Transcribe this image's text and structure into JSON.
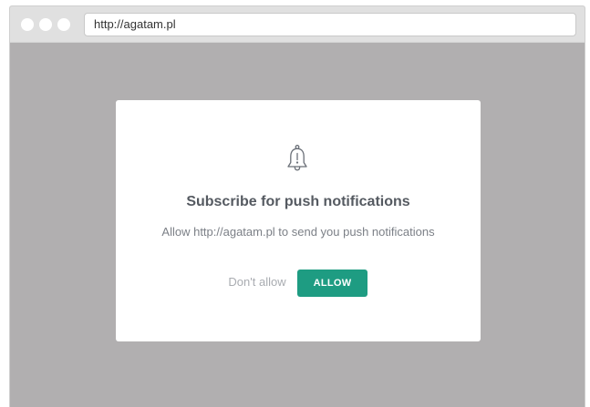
{
  "browser": {
    "url": "http://agatam.pl",
    "window_controls": [
      "window-dot-icon",
      "window-dot-icon",
      "window-dot-icon"
    ]
  },
  "dialog": {
    "icon": "bell-icon",
    "title": "Subscribe for push notifications",
    "message": "Allow http://agatam.pl to send you push notifications",
    "deny_label": "Don't allow",
    "allow_label": "ALLOW"
  },
  "colors": {
    "overlay": "#b1afb0",
    "toolbar": "#e0e0e0",
    "accent": "#1e9c82",
    "title_text": "#555a61",
    "muted_text": "#a9acb1"
  }
}
